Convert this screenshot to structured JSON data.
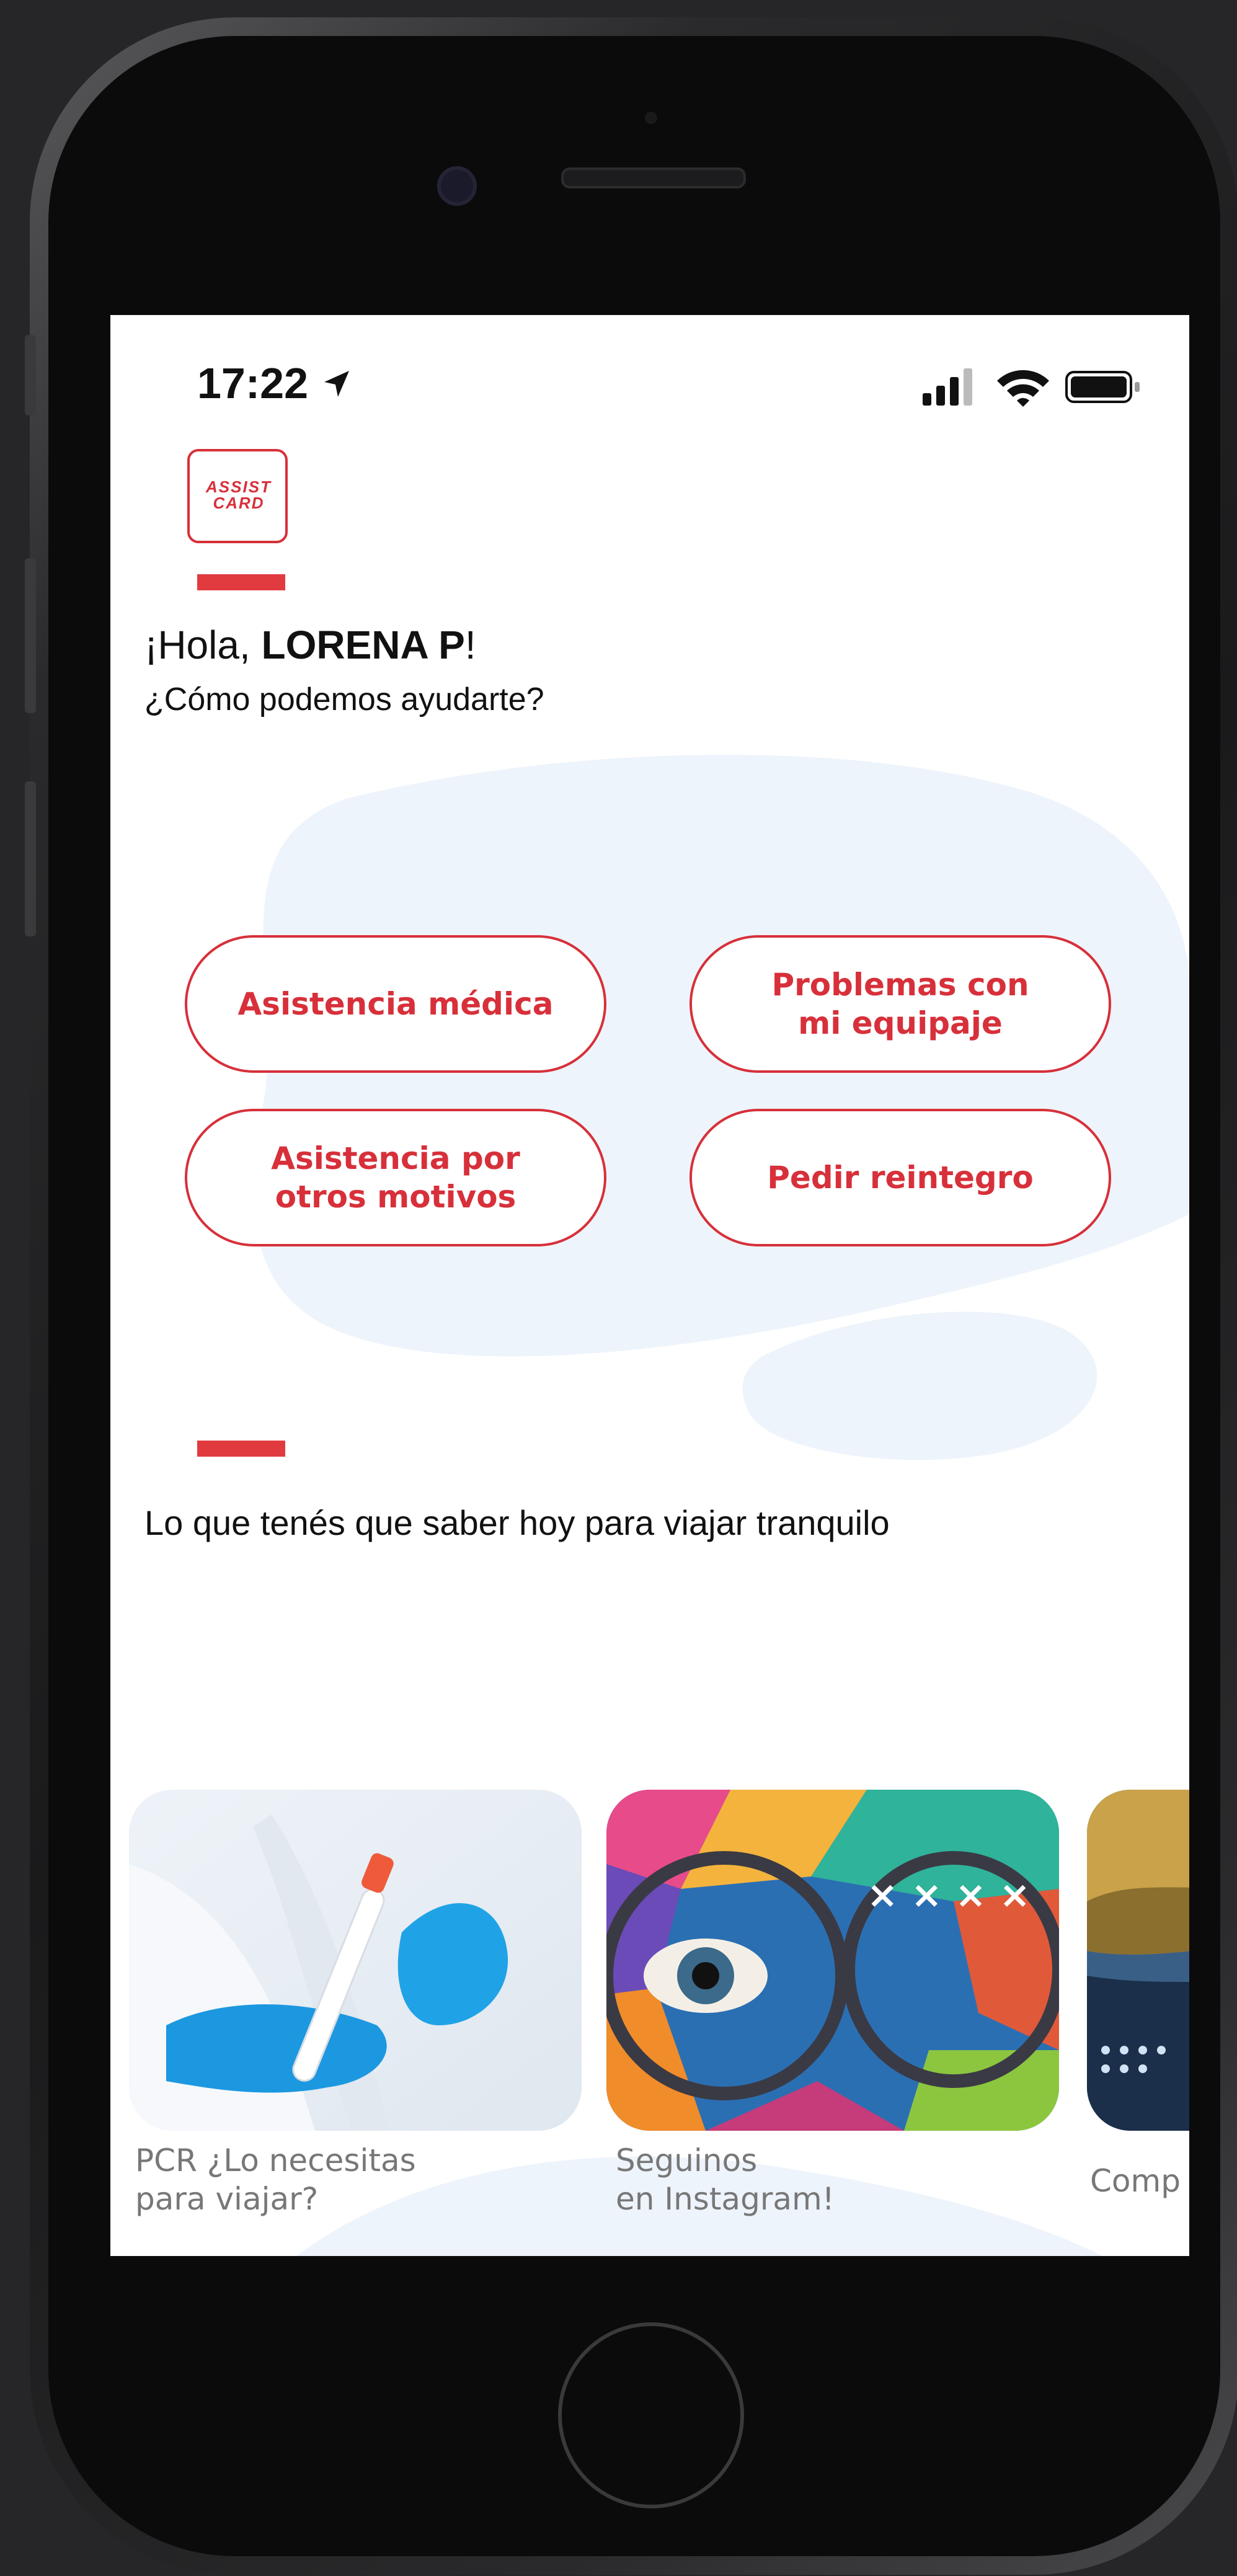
{
  "status_bar": {
    "time": "17:22"
  },
  "header": {
    "logo_text": "ASSIST CARD",
    "greeting_prefix": "¡Hola, ",
    "user_name": "LORENA P",
    "greeting_suffix": "!",
    "subtitle": "¿Cómo podemos ayudarte?"
  },
  "actions": [
    {
      "label": "Asistencia médica"
    },
    {
      "label": "Problemas con\nmi equipaje"
    },
    {
      "label": "Asistencia por\notros motivos"
    },
    {
      "label": "Pedir reintegro"
    }
  ],
  "news": {
    "title": "Lo que tenés que saber hoy para viajar tranquilo",
    "cards": [
      {
        "caption": "PCR ¿Lo necesitas\npara viajar?",
        "image": "pcr-test-tube-gloves"
      },
      {
        "caption": "Seguinos\nen  Instagram!",
        "image": "colorful-eye-mural"
      },
      {
        "caption": "Comp",
        "image": "landscape-photo"
      }
    ]
  },
  "colors": {
    "brand_red": "#d7303a",
    "accent_bar": "#e13b40",
    "blob": "#eef4fb"
  }
}
